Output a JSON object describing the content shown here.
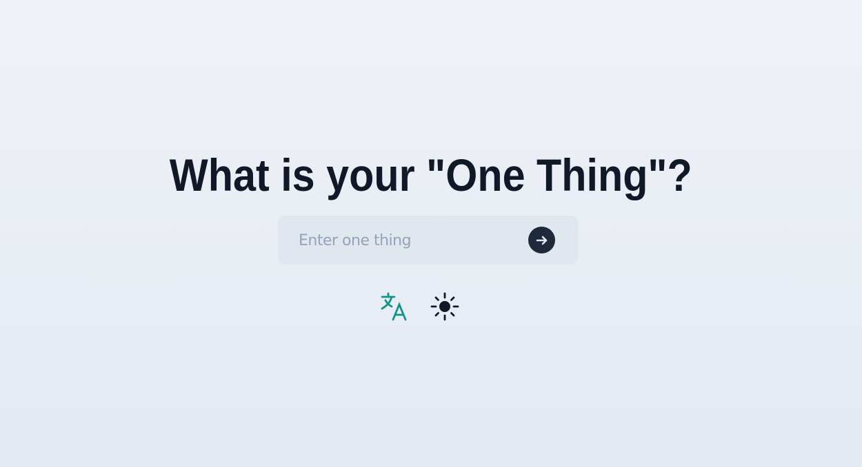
{
  "heading": "What is your \"One Thing\"?",
  "input": {
    "placeholder": "Enter one thing",
    "value": ""
  },
  "icons": {
    "submit": "arrow-right-icon",
    "language": "translate-icon",
    "theme": "sun-icon"
  },
  "colors": {
    "accent": "#0f9488",
    "text": "#111827",
    "button": "#1e293b"
  }
}
